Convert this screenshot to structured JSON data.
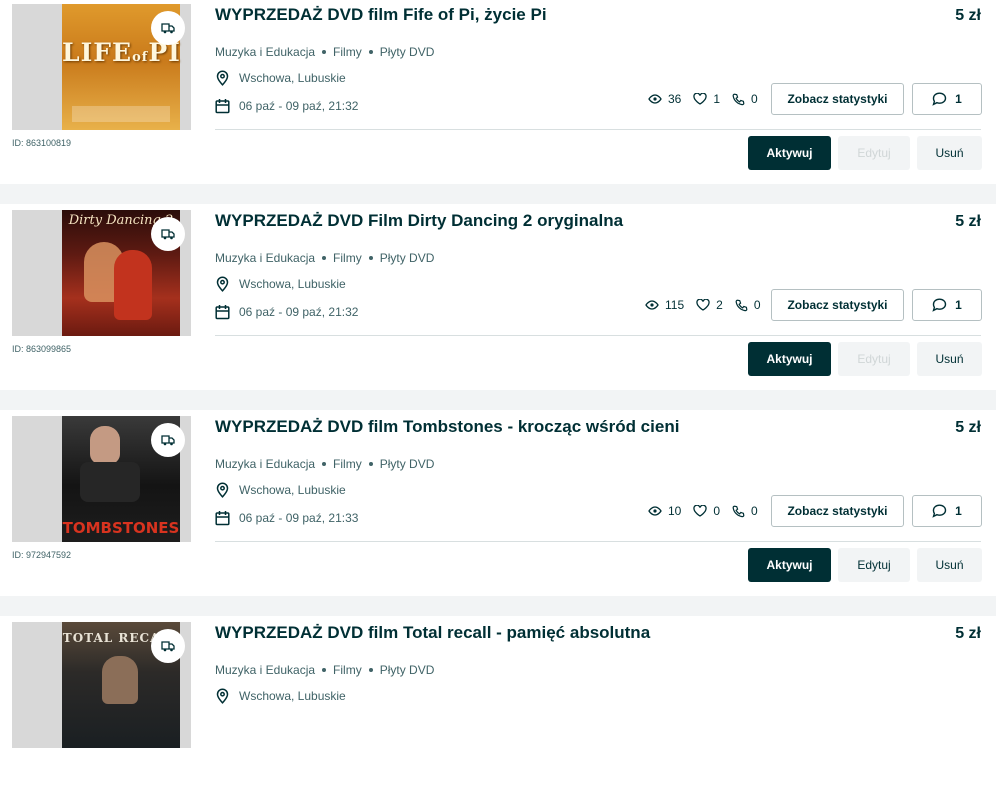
{
  "listings": [
    {
      "title": "WYPRZEDAŻ DVD film Fife of Pi, życie Pi",
      "price": "5 zł",
      "category": [
        "Muzyka i Edukacja",
        "Filmy",
        "Płyty DVD"
      ],
      "location": "Wschowa, Lubuskie",
      "dates": "06 paź - 09 paź, 21:32",
      "views": "36",
      "likes": "1",
      "calls": "0",
      "messages": "1",
      "id": "ID: 863100819",
      "cover_text": [
        "LIFE",
        "of",
        "PI"
      ],
      "edit_enabled": false
    },
    {
      "title": "WYPRZEDAŻ DVD Film Dirty Dancing 2 oryginalna",
      "price": "5 zł",
      "category": [
        "Muzyka i Edukacja",
        "Filmy",
        "Płyty DVD"
      ],
      "location": "Wschowa, Lubuskie",
      "dates": "06 paź - 09 paź, 21:32",
      "views": "115",
      "likes": "2",
      "calls": "0",
      "messages": "1",
      "id": "ID: 863099865",
      "cover_text": [
        "Dirty Dancing 2"
      ],
      "edit_enabled": false
    },
    {
      "title": "WYPRZEDAŻ DVD film Tombstones - krocząc wśród cieni",
      "price": "5 zł",
      "category": [
        "Muzyka i Edukacja",
        "Filmy",
        "Płyty DVD"
      ],
      "location": "Wschowa, Lubuskie",
      "dates": "06 paź - 09 paź, 21:33",
      "views": "10",
      "likes": "0",
      "calls": "0",
      "messages": "1",
      "id": "ID: 972947592",
      "cover_text": [
        "TOMBSTONES"
      ],
      "edit_enabled": true
    },
    {
      "title": "WYPRZEDAŻ DVD film Total recall - pamięć absolutna",
      "price": "5 zł",
      "category": [
        "Muzyka i Edukacja",
        "Filmy",
        "Płyty DVD"
      ],
      "location": "Wschowa, Lubuskie",
      "cover_text": [
        "TOTAL RECALL"
      ]
    }
  ],
  "buttons": {
    "stats": "Zobacz statystyki",
    "activate": "Aktywuj",
    "edit": "Edytuj",
    "delete": "Usuń"
  },
  "colors": {
    "primary": "#002f34",
    "muted_text": "#406367",
    "page_background": "#f2f4f5",
    "card_background": "#ffffff"
  },
  "icons": [
    "delivery-truck-icon",
    "location-pin-icon",
    "calendar-icon",
    "eye-icon",
    "heart-icon",
    "phone-icon",
    "message-bubble-icon"
  ]
}
